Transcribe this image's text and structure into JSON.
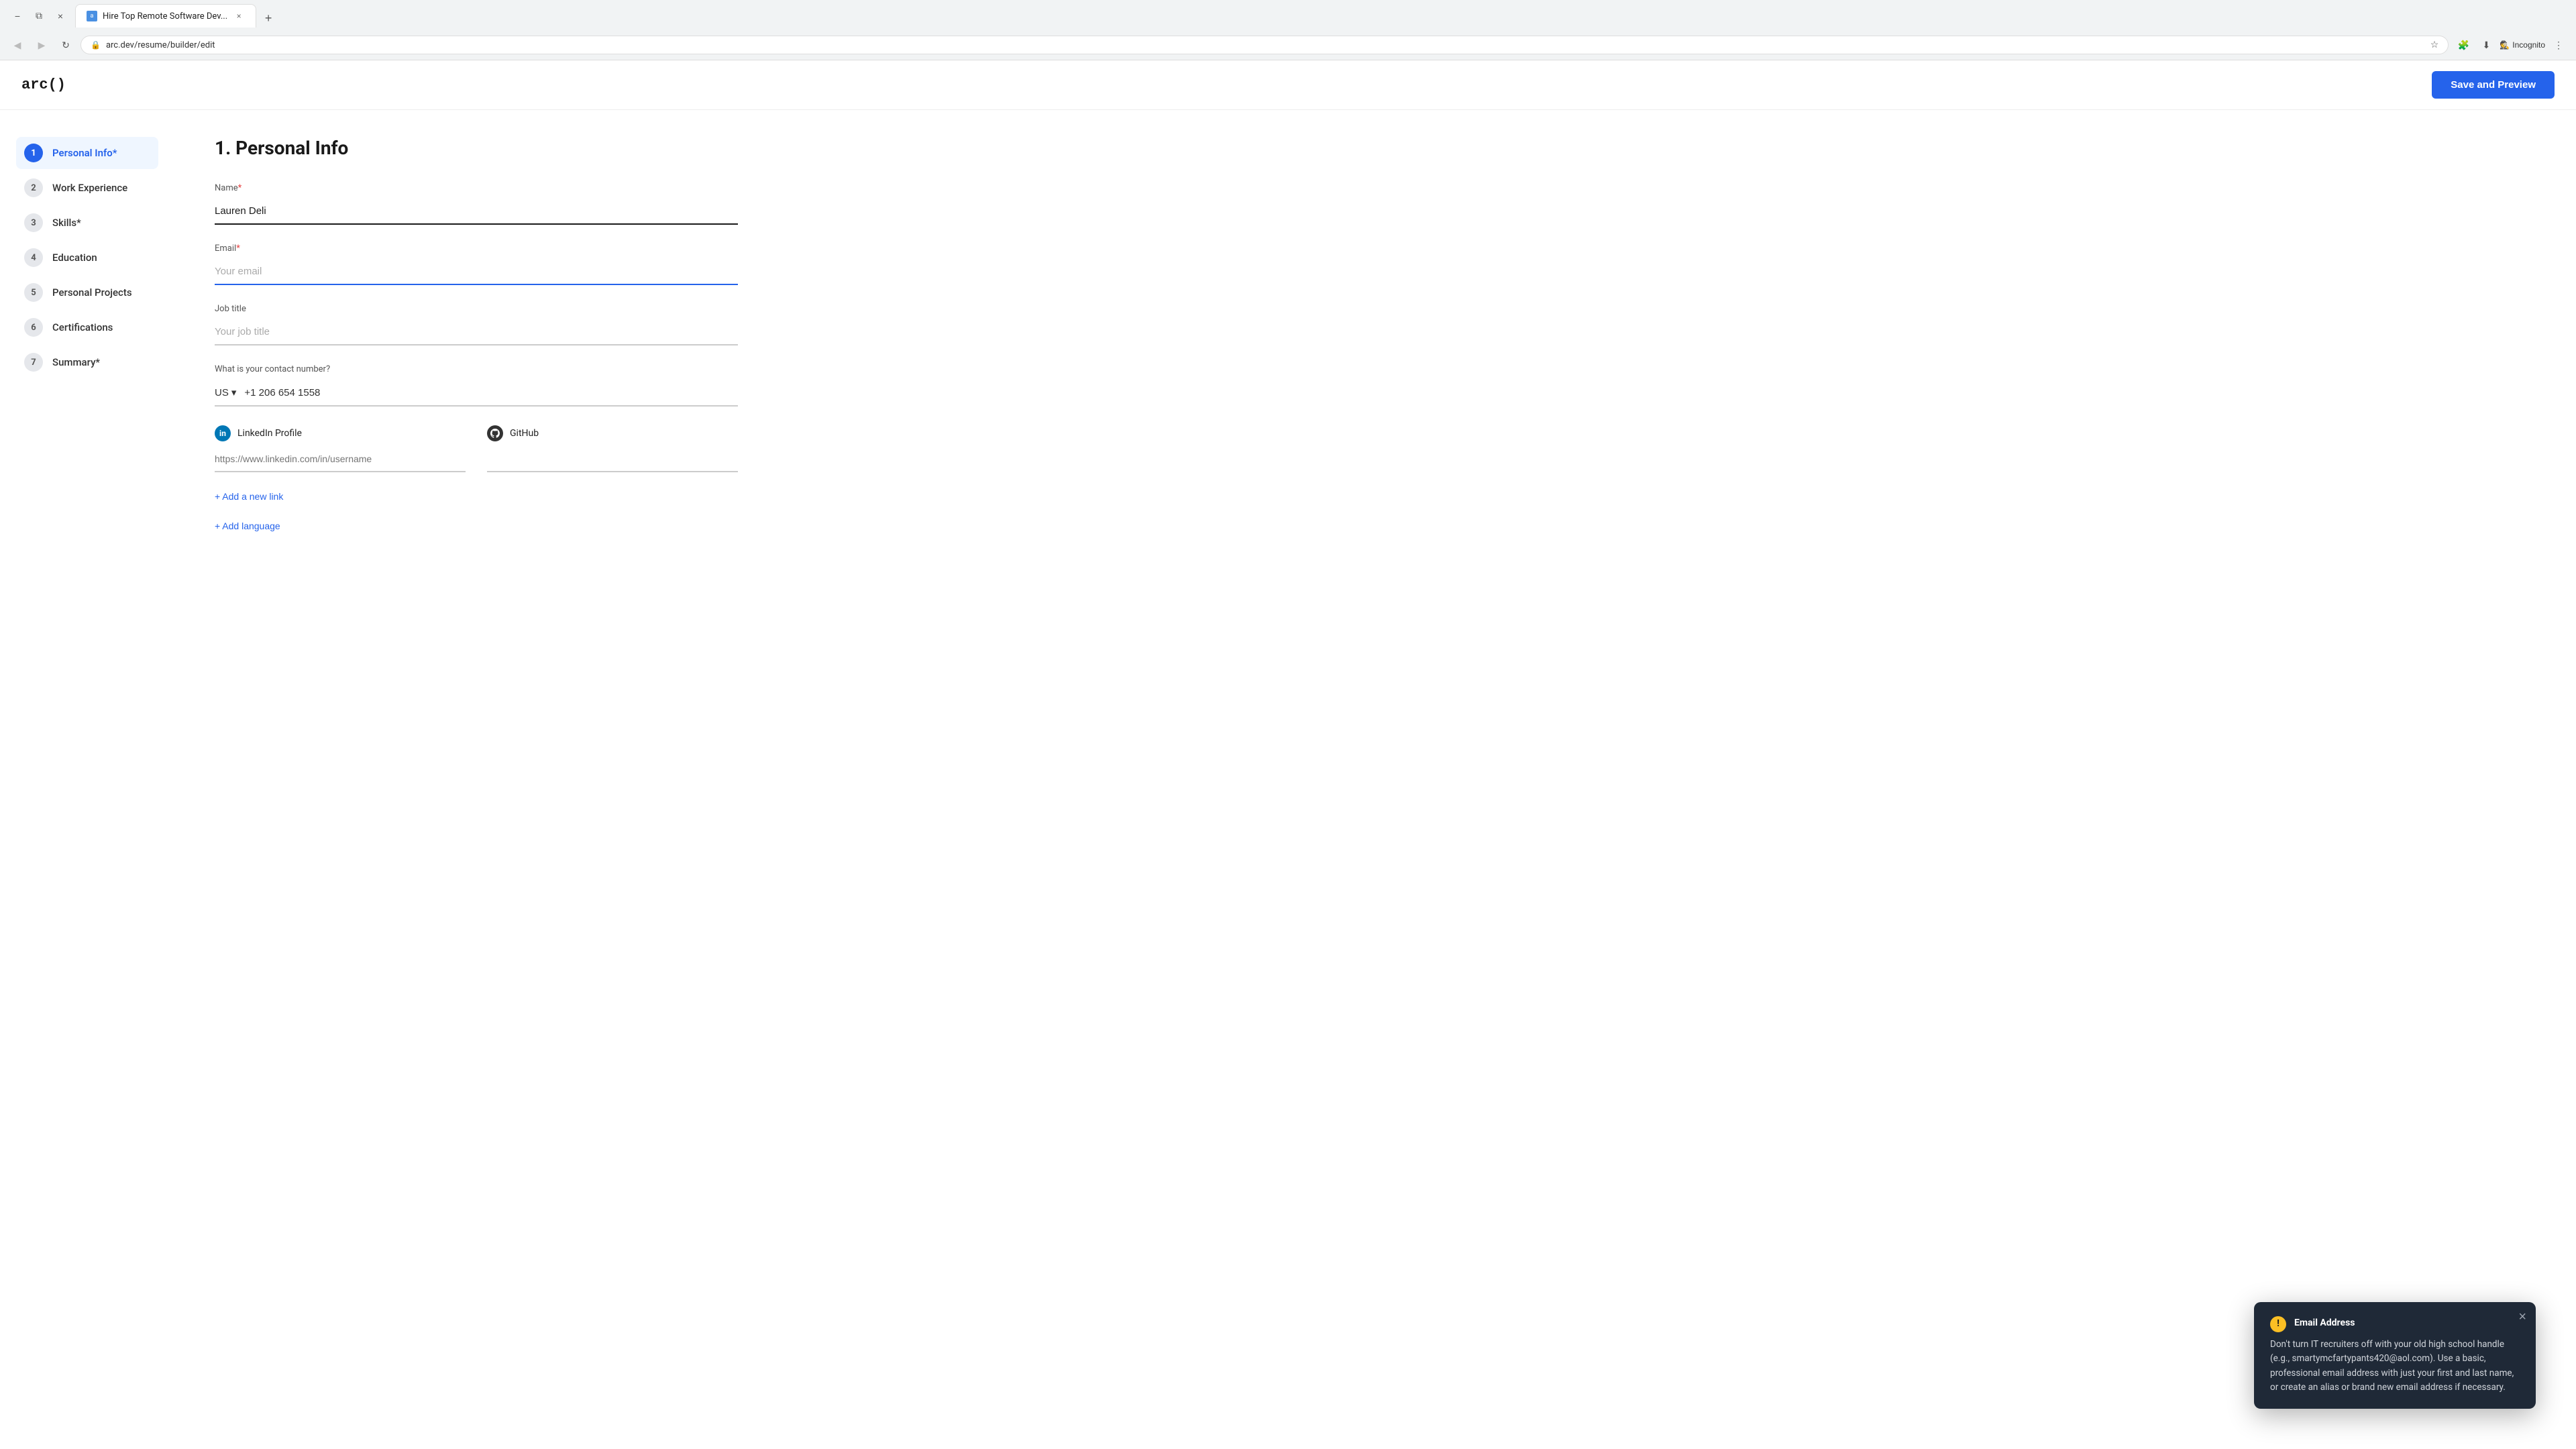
{
  "browser": {
    "tab_title": "Hire Top Remote Software Dev...",
    "tab_close_label": "×",
    "new_tab_label": "+",
    "address": "arc.dev/resume/builder/edit",
    "back_icon": "◀",
    "forward_icon": "▶",
    "refresh_icon": "↻",
    "star_icon": "☆",
    "download_icon": "⬇",
    "extensions_icon": "🧩",
    "incognito_label": "Incognito",
    "minimize_icon": "−",
    "restore_icon": "⧉",
    "close_icon": "×",
    "more_icon": "⋮"
  },
  "header": {
    "logo": "arc()",
    "save_button_label": "Save and Preview"
  },
  "sidebar": {
    "items": [
      {
        "num": "1",
        "label": "Personal Info*",
        "active": true
      },
      {
        "num": "2",
        "label": "Work Experience"
      },
      {
        "num": "3",
        "label": "Skills*"
      },
      {
        "num": "4",
        "label": "Education"
      },
      {
        "num": "5",
        "label": "Personal Projects"
      },
      {
        "num": "6",
        "label": "Certifications"
      },
      {
        "num": "7",
        "label": "Summary*"
      }
    ]
  },
  "form": {
    "section_title": "1. Personal Info",
    "name_label": "Name",
    "name_required": "*",
    "name_value": "Lauren Deli",
    "email_label": "Email",
    "email_required": "*",
    "email_placeholder": "Your email",
    "job_title_label": "Job title",
    "job_title_placeholder": "Your job title",
    "contact_label": "What is your contact number?",
    "country_code": "US",
    "phone_number": "+1 206 654 1558",
    "linkedin_label": "LinkedIn Profile",
    "linkedin_placeholder": "https://www.linkedin.com/in/username",
    "github_label": "GitHub",
    "add_link_label": "+ Add a new link",
    "add_language_label": "+ Add language"
  },
  "tooltip": {
    "icon_label": "!",
    "title_bold": "Email Address",
    "title_rest": " - Don't turn IT recruiters off with your old high school handle (e.g., smartymcfartypants420@aol.com). Use a basic, professional email address with just your first and last name, or create an alias or brand new email address if necessary.",
    "close_label": "×"
  }
}
